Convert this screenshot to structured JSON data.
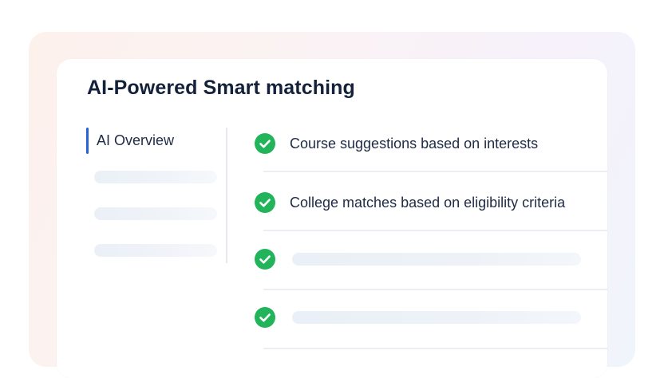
{
  "card": {
    "title": "AI-Powered Smart matching"
  },
  "sidebar": {
    "active_item": "AI Overview",
    "placeholder_item_count": 3,
    "accent_color": "#2563d6"
  },
  "features": {
    "check_color": "#22b45a",
    "items": [
      {
        "label": "Course suggestions based on interests",
        "checked": true
      },
      {
        "label": "College matches based on eligibility criteria",
        "checked": true
      },
      {
        "label": "",
        "checked": true,
        "placeholder": true
      },
      {
        "label": "",
        "checked": true,
        "placeholder": true
      }
    ]
  },
  "icons": {
    "feature_check": "check-circle-icon"
  }
}
